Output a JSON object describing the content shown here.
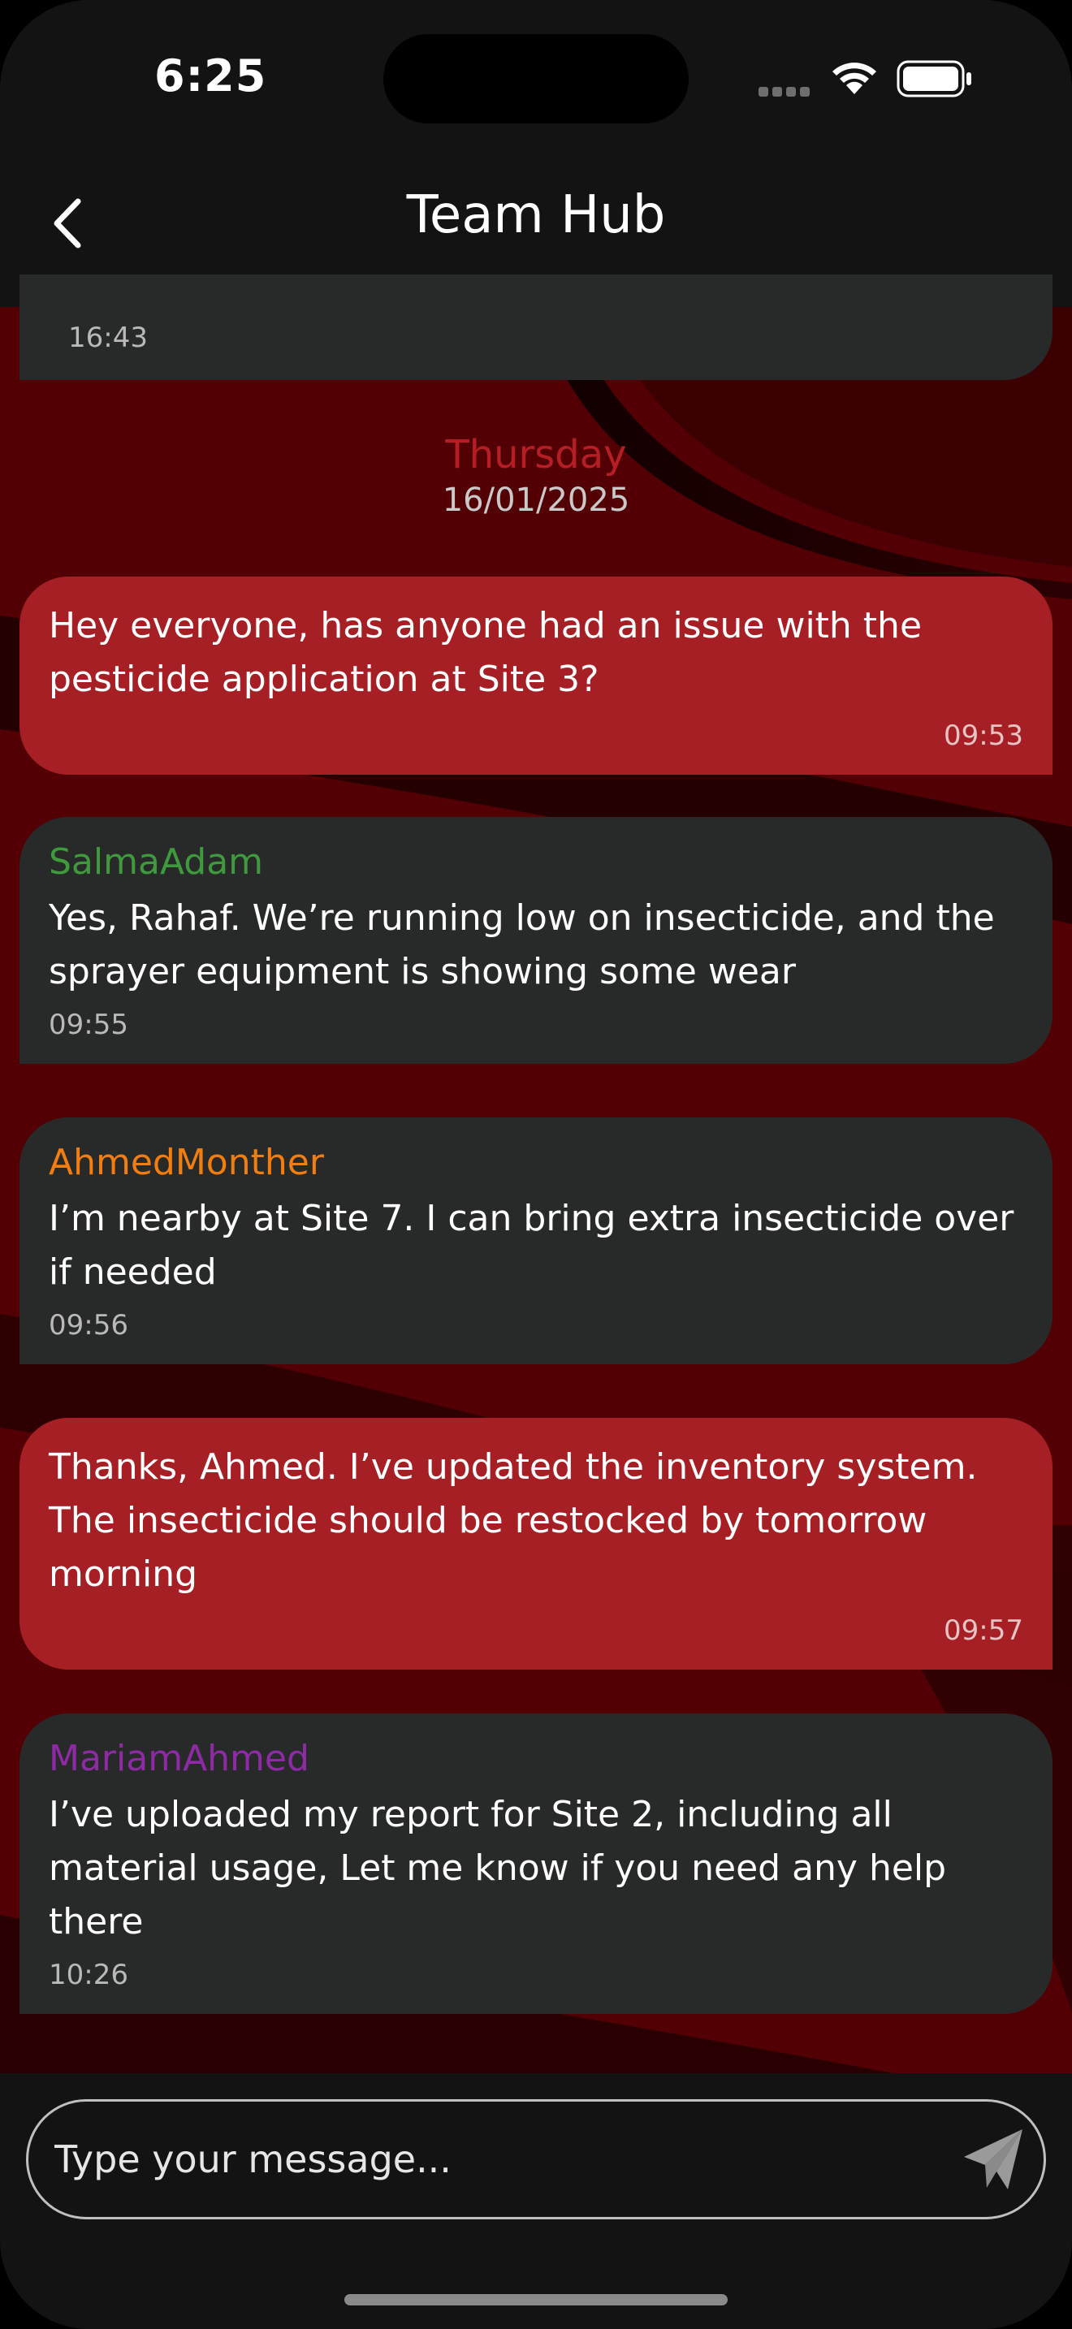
{
  "status_bar": {
    "time": "6:25"
  },
  "header": {
    "title": "Team Hub"
  },
  "conversation": {
    "previous_time": "16:43",
    "day_separator": {
      "day": "Thursday",
      "date": "16/01/2025"
    },
    "messages": [
      {
        "from_me": true,
        "sender": "",
        "text": "Hey everyone, has anyone had an issue with the pesticide application at Site 3?",
        "time": "09:53"
      },
      {
        "from_me": false,
        "sender": "SalmaAdam",
        "sender_color": "#3f9a3d",
        "text": "Yes, Rahaf. We’re running low on insecticide, and the sprayer equipment is showing some wear",
        "time": "09:55"
      },
      {
        "from_me": false,
        "sender": "AhmedMonther",
        "sender_color": "#f27e0f",
        "text": "I’m nearby at Site 7. I can bring extra insecticide over if needed",
        "time": "09:56"
      },
      {
        "from_me": true,
        "sender": "",
        "text": "Thanks, Ahmed. I’ve updated the inventory system. The insecticide should be restocked by tomorrow morning",
        "time": "09:57"
      },
      {
        "from_me": false,
        "sender": "MariamAhmed",
        "sender_color": "#8e2aa6",
        "text": "I’ve uploaded my report for Site 2, including all material usage, Let me know if you need any help there",
        "time": "10:26"
      }
    ]
  },
  "composer": {
    "placeholder": "Type your message..."
  },
  "icons": {
    "back": "chevron-left-icon",
    "send": "send-plane-icon",
    "wifi": "wifi-icon",
    "battery": "battery-icon"
  },
  "colors": {
    "accent": "#a51f24",
    "bubble_other": "#282a29",
    "background": "#131313"
  }
}
